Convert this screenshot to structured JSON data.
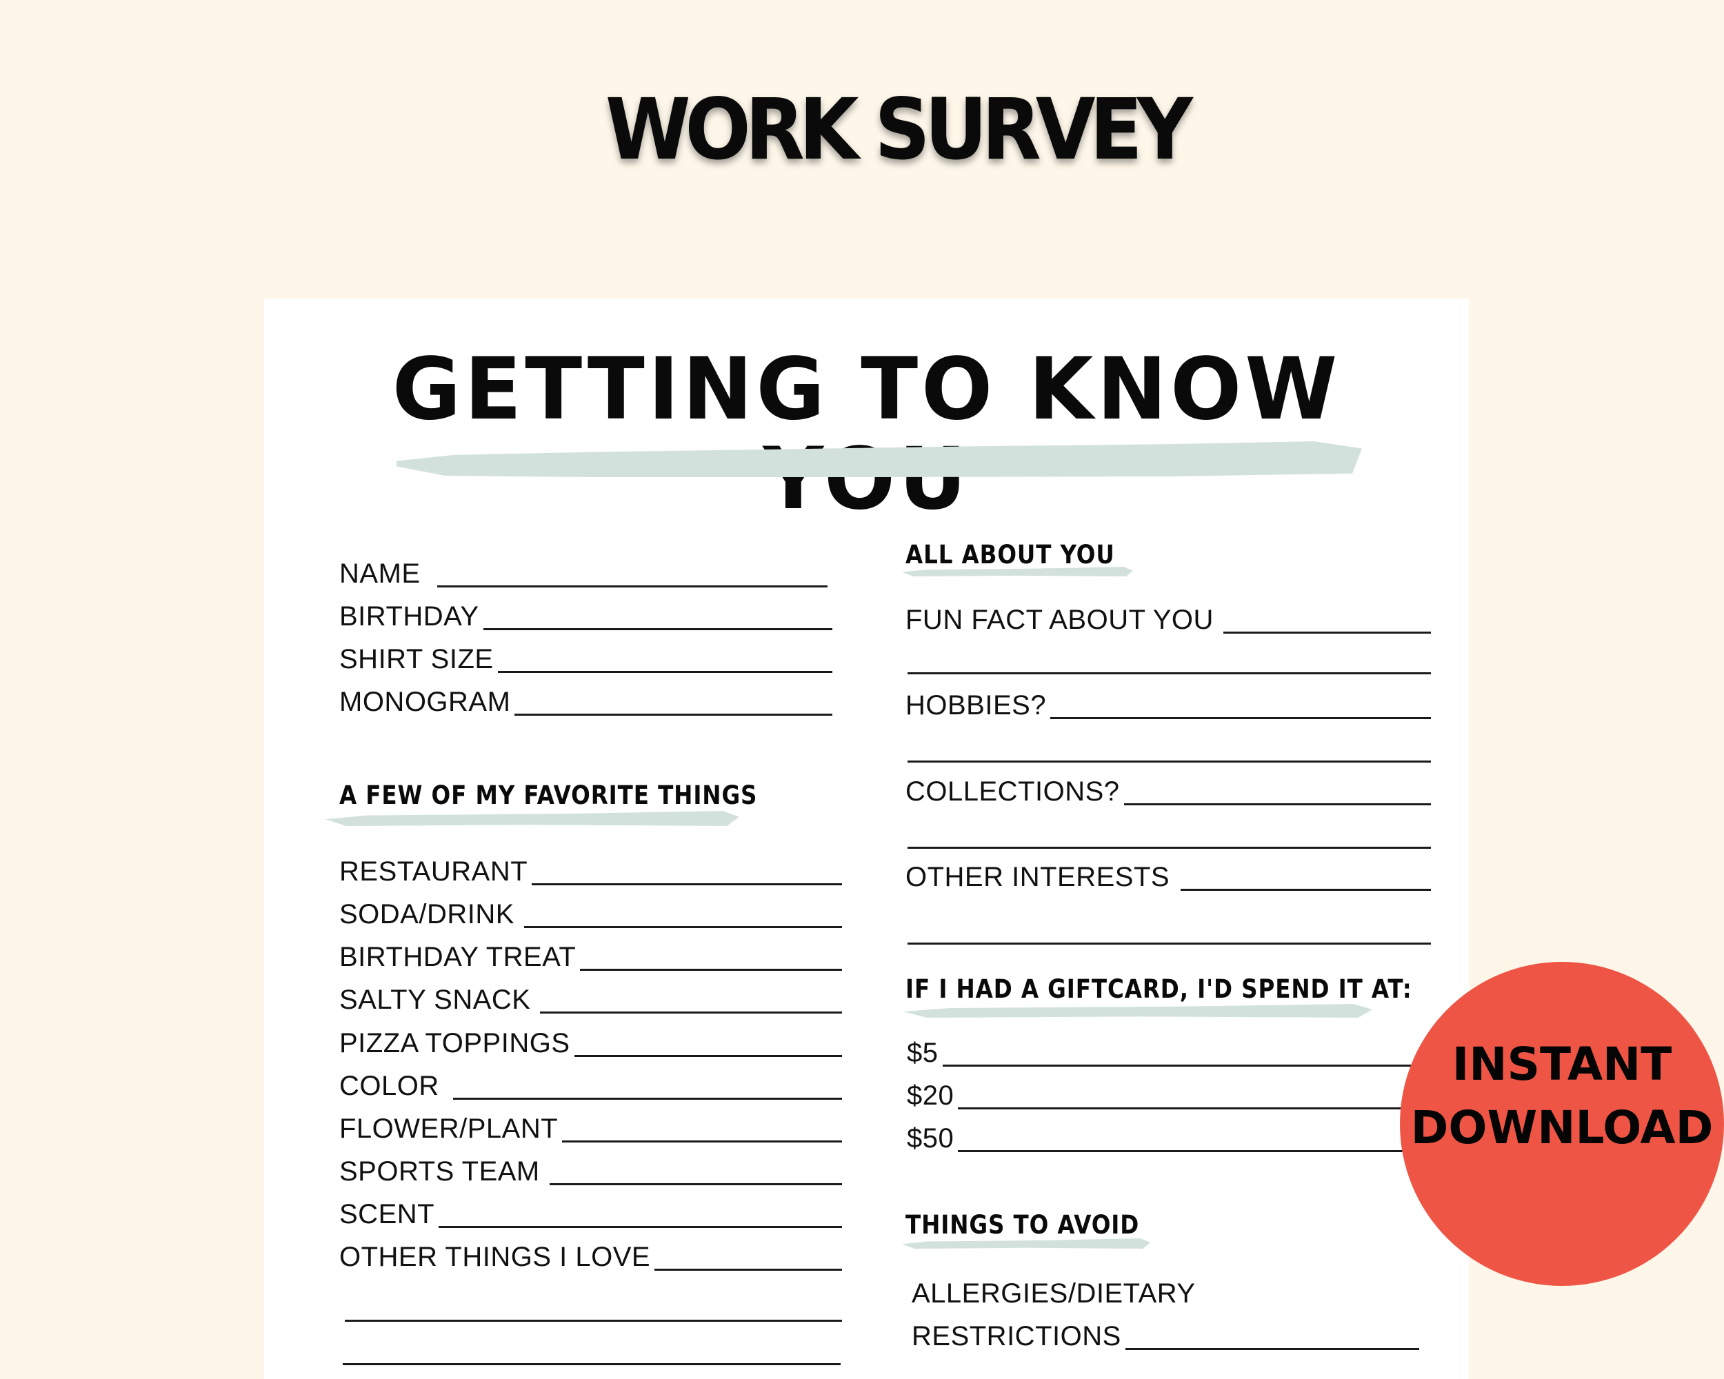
{
  "hero_title": "WORK SURVEY",
  "document": {
    "title": "GETTING TO KNOW YOU",
    "accent_color": "#d3e1dc",
    "personal_fields": [
      {
        "label": "NAME",
        "value": ""
      },
      {
        "label": "BIRTHDAY",
        "value": ""
      },
      {
        "label": "SHIRT SIZE",
        "value": ""
      },
      {
        "label": "MONOGRAM",
        "value": ""
      }
    ],
    "favorites": {
      "heading": "A FEW OF MY FAVORITE THINGS",
      "fields": [
        {
          "label": "RESTAURANT",
          "value": ""
        },
        {
          "label": "SODA/DRINK",
          "value": ""
        },
        {
          "label": "BIRTHDAY TREAT",
          "value": ""
        },
        {
          "label": "SALTY SNACK",
          "value": ""
        },
        {
          "label": "PIZZA TOPPINGS",
          "value": ""
        },
        {
          "label": "COLOR",
          "value": ""
        },
        {
          "label": "FLOWER/PLANT",
          "value": ""
        },
        {
          "label": "SPORTS TEAM",
          "value": ""
        },
        {
          "label": "SCENT",
          "value": ""
        },
        {
          "label": "OTHER THINGS I LOVE",
          "value": ""
        }
      ]
    },
    "about_you": {
      "heading": "ALL ABOUT YOU",
      "fields": [
        {
          "label": "FUN FACT ABOUT YOU",
          "value": ""
        },
        {
          "label": "HOBBIES?",
          "value": ""
        },
        {
          "label": "COLLECTIONS?",
          "value": ""
        },
        {
          "label": "OTHER INTERESTS",
          "value": ""
        }
      ]
    },
    "giftcard": {
      "heading": "IF I HAD A GIFTCARD, I'D SPEND IT AT:",
      "fields": [
        {
          "label": "$5",
          "value": ""
        },
        {
          "label": "$20",
          "value": ""
        },
        {
          "label": "$50",
          "value": ""
        }
      ]
    },
    "avoid": {
      "heading": "THINGS TO AVOID",
      "label_line1": "ALLERGIES/DIETARY",
      "label_line2": "RESTRICTIONS",
      "value": ""
    }
  },
  "badge": {
    "line1": "INSTANT",
    "line2": "DOWNLOAD",
    "color": "#ee5545"
  }
}
